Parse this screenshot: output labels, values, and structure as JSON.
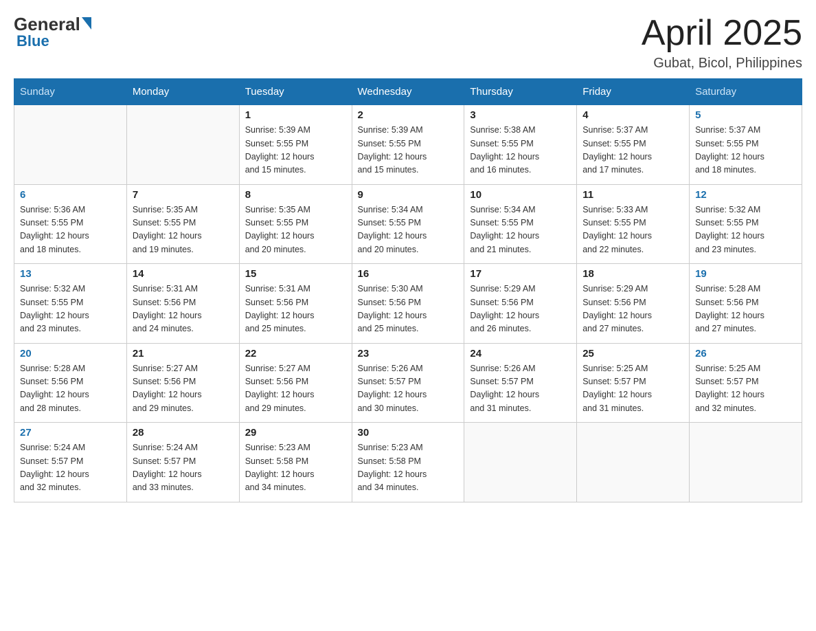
{
  "logo": {
    "general": "General",
    "blue": "Blue"
  },
  "title": "April 2025",
  "location": "Gubat, Bicol, Philippines",
  "headers": [
    "Sunday",
    "Monday",
    "Tuesday",
    "Wednesday",
    "Thursday",
    "Friday",
    "Saturday"
  ],
  "weeks": [
    [
      {
        "day": "",
        "info": ""
      },
      {
        "day": "",
        "info": ""
      },
      {
        "day": "1",
        "info": "Sunrise: 5:39 AM\nSunset: 5:55 PM\nDaylight: 12 hours\nand 15 minutes."
      },
      {
        "day": "2",
        "info": "Sunrise: 5:39 AM\nSunset: 5:55 PM\nDaylight: 12 hours\nand 15 minutes."
      },
      {
        "day": "3",
        "info": "Sunrise: 5:38 AM\nSunset: 5:55 PM\nDaylight: 12 hours\nand 16 minutes."
      },
      {
        "day": "4",
        "info": "Sunrise: 5:37 AM\nSunset: 5:55 PM\nDaylight: 12 hours\nand 17 minutes."
      },
      {
        "day": "5",
        "info": "Sunrise: 5:37 AM\nSunset: 5:55 PM\nDaylight: 12 hours\nand 18 minutes."
      }
    ],
    [
      {
        "day": "6",
        "info": "Sunrise: 5:36 AM\nSunset: 5:55 PM\nDaylight: 12 hours\nand 18 minutes."
      },
      {
        "day": "7",
        "info": "Sunrise: 5:35 AM\nSunset: 5:55 PM\nDaylight: 12 hours\nand 19 minutes."
      },
      {
        "day": "8",
        "info": "Sunrise: 5:35 AM\nSunset: 5:55 PM\nDaylight: 12 hours\nand 20 minutes."
      },
      {
        "day": "9",
        "info": "Sunrise: 5:34 AM\nSunset: 5:55 PM\nDaylight: 12 hours\nand 20 minutes."
      },
      {
        "day": "10",
        "info": "Sunrise: 5:34 AM\nSunset: 5:55 PM\nDaylight: 12 hours\nand 21 minutes."
      },
      {
        "day": "11",
        "info": "Sunrise: 5:33 AM\nSunset: 5:55 PM\nDaylight: 12 hours\nand 22 minutes."
      },
      {
        "day": "12",
        "info": "Sunrise: 5:32 AM\nSunset: 5:55 PM\nDaylight: 12 hours\nand 23 minutes."
      }
    ],
    [
      {
        "day": "13",
        "info": "Sunrise: 5:32 AM\nSunset: 5:55 PM\nDaylight: 12 hours\nand 23 minutes."
      },
      {
        "day": "14",
        "info": "Sunrise: 5:31 AM\nSunset: 5:56 PM\nDaylight: 12 hours\nand 24 minutes."
      },
      {
        "day": "15",
        "info": "Sunrise: 5:31 AM\nSunset: 5:56 PM\nDaylight: 12 hours\nand 25 minutes."
      },
      {
        "day": "16",
        "info": "Sunrise: 5:30 AM\nSunset: 5:56 PM\nDaylight: 12 hours\nand 25 minutes."
      },
      {
        "day": "17",
        "info": "Sunrise: 5:29 AM\nSunset: 5:56 PM\nDaylight: 12 hours\nand 26 minutes."
      },
      {
        "day": "18",
        "info": "Sunrise: 5:29 AM\nSunset: 5:56 PM\nDaylight: 12 hours\nand 27 minutes."
      },
      {
        "day": "19",
        "info": "Sunrise: 5:28 AM\nSunset: 5:56 PM\nDaylight: 12 hours\nand 27 minutes."
      }
    ],
    [
      {
        "day": "20",
        "info": "Sunrise: 5:28 AM\nSunset: 5:56 PM\nDaylight: 12 hours\nand 28 minutes."
      },
      {
        "day": "21",
        "info": "Sunrise: 5:27 AM\nSunset: 5:56 PM\nDaylight: 12 hours\nand 29 minutes."
      },
      {
        "day": "22",
        "info": "Sunrise: 5:27 AM\nSunset: 5:56 PM\nDaylight: 12 hours\nand 29 minutes."
      },
      {
        "day": "23",
        "info": "Sunrise: 5:26 AM\nSunset: 5:57 PM\nDaylight: 12 hours\nand 30 minutes."
      },
      {
        "day": "24",
        "info": "Sunrise: 5:26 AM\nSunset: 5:57 PM\nDaylight: 12 hours\nand 31 minutes."
      },
      {
        "day": "25",
        "info": "Sunrise: 5:25 AM\nSunset: 5:57 PM\nDaylight: 12 hours\nand 31 minutes."
      },
      {
        "day": "26",
        "info": "Sunrise: 5:25 AM\nSunset: 5:57 PM\nDaylight: 12 hours\nand 32 minutes."
      }
    ],
    [
      {
        "day": "27",
        "info": "Sunrise: 5:24 AM\nSunset: 5:57 PM\nDaylight: 12 hours\nand 32 minutes."
      },
      {
        "day": "28",
        "info": "Sunrise: 5:24 AM\nSunset: 5:57 PM\nDaylight: 12 hours\nand 33 minutes."
      },
      {
        "day": "29",
        "info": "Sunrise: 5:23 AM\nSunset: 5:58 PM\nDaylight: 12 hours\nand 34 minutes."
      },
      {
        "day": "30",
        "info": "Sunrise: 5:23 AM\nSunset: 5:58 PM\nDaylight: 12 hours\nand 34 minutes."
      },
      {
        "day": "",
        "info": ""
      },
      {
        "day": "",
        "info": ""
      },
      {
        "day": "",
        "info": ""
      }
    ]
  ]
}
